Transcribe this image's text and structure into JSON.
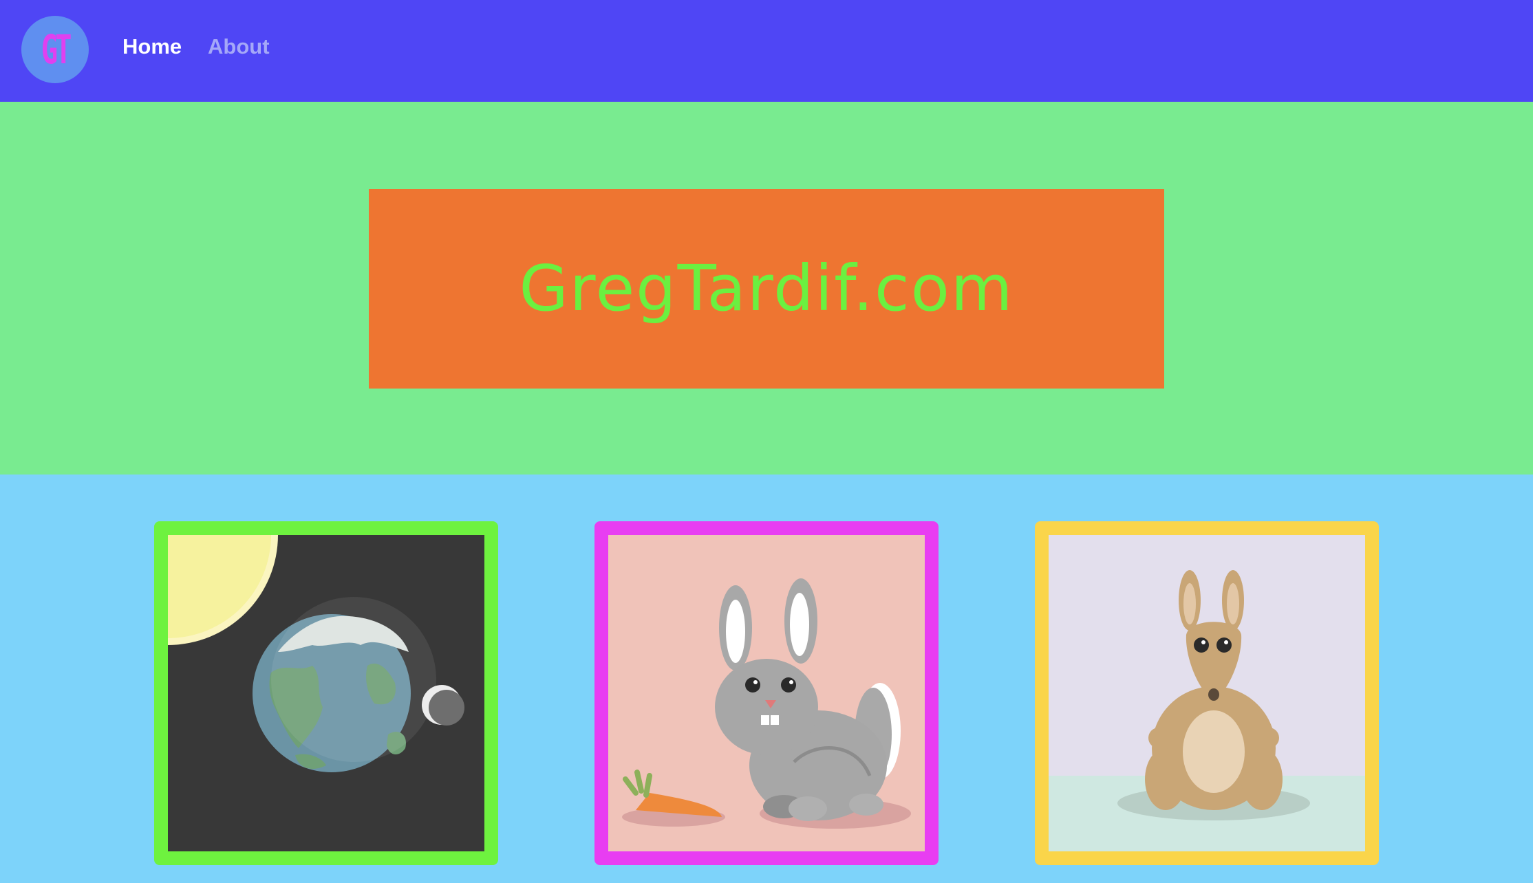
{
  "nav": {
    "logo_text": "GT",
    "links": [
      {
        "label": "Home",
        "active": true
      },
      {
        "label": "About",
        "active": false
      }
    ]
  },
  "hero": {
    "title": "GregTardif.com"
  },
  "colors": {
    "nav_bg": "#4F46F5",
    "hero_bg": "#79EB90",
    "banner_bg": "#EE7531",
    "title_color": "#6BF040",
    "gallery_bg": "#7DD3FA",
    "card_borders": [
      "#6EF23F",
      "#E83DF2",
      "#FAD54A"
    ]
  },
  "gallery": {
    "cards": [
      {
        "subject": "earth-moon-sun"
      },
      {
        "subject": "rabbit-carrot"
      },
      {
        "subject": "kangaroo"
      }
    ]
  }
}
